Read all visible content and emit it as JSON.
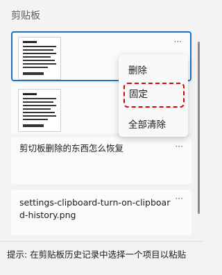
{
  "panel": {
    "title": "剪贴板",
    "hint": "提示: 在剪贴板历史记录中选择一个项目以粘贴"
  },
  "items": [
    {
      "type": "image",
      "more_label": "···"
    },
    {
      "type": "image",
      "more_label": "···"
    },
    {
      "type": "text",
      "text": "剪切板删除的东西怎么恢复",
      "more_label": "···"
    },
    {
      "type": "text",
      "text": "settings-clipboard-turn-on-clipboard-history.png",
      "more_label": "···"
    }
  ],
  "context_menu": {
    "items": [
      {
        "label": "删除"
      },
      {
        "label": "固定"
      },
      {
        "label": "全部清除"
      }
    ],
    "highlighted_item": "固定",
    "highlight_color": "#e00000"
  },
  "colors": {
    "selection_border": "#1a73c8",
    "background": "#f3f3f3",
    "card": "#fbfbfb"
  }
}
